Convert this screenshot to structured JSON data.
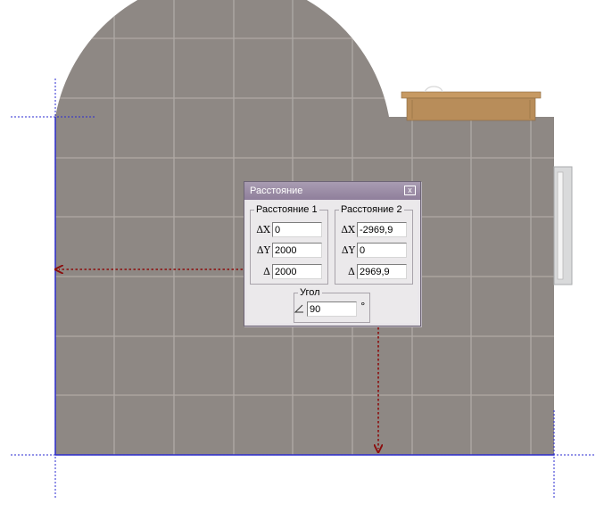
{
  "dialog": {
    "title": "Расстояние",
    "close_label": "x",
    "group1": {
      "legend": "Расстояние 1",
      "dx_label": "ΔX",
      "dx_value": "0",
      "dy_label": "ΔY",
      "dy_value": "2000",
      "d_label": "Δ",
      "d_value": "2000"
    },
    "group2": {
      "legend": "Расстояние 2",
      "dx_label": "ΔX",
      "dx_value": "-2969,9",
      "dy_label": "ΔY",
      "dy_value": "0",
      "d_label": "Δ",
      "d_value": "2969,9"
    },
    "angle": {
      "legend": "Угол",
      "icon": "angle-icon",
      "value": "90",
      "unit": "°"
    }
  },
  "colors": {
    "floor": "#8e8884",
    "grid": "#b6b0ab",
    "wall_edge": "#2c2cc8",
    "guide": "#2a2ad0",
    "arrow": "#8b0d0d",
    "furniture": "#b88d5a",
    "dialog_title": "#9b8ca6"
  }
}
